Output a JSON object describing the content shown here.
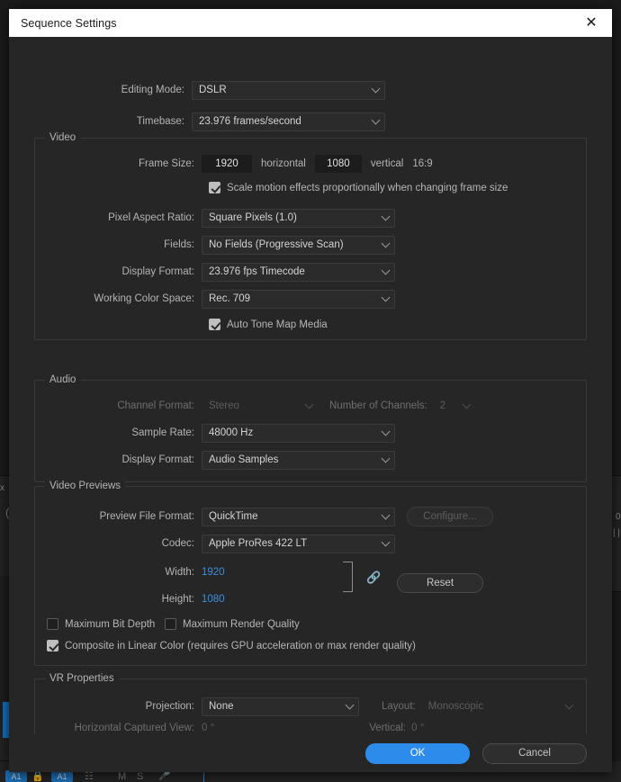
{
  "background": {
    "track_buttons": [
      "A1",
      "A1"
    ],
    "track_icons": [
      "lock-icon",
      "timeline-icon",
      "M",
      "S",
      "mic-icon"
    ],
    "panel_glyphs": [
      "x",
      "(",
      "0"
    ]
  },
  "dialog": {
    "title": "Sequence Settings",
    "close_icon": "close-icon",
    "top_fields": [
      {
        "label": "Editing Mode:",
        "value": "DSLR",
        "disabled": false
      },
      {
        "label": "Timebase:",
        "value": "23.976  frames/second",
        "disabled": false
      }
    ],
    "video": {
      "legend": "Video",
      "frame_size_label": "Frame Size:",
      "frame_width": "1920",
      "horizontal_label": "horizontal",
      "frame_height": "1080",
      "vertical_label": "vertical",
      "aspect_ratio": "16:9",
      "scale_motion": {
        "label": "Scale motion effects proportionally when changing frame size",
        "checked": true
      },
      "fields": [
        {
          "label": "Pixel Aspect Ratio:",
          "value": "Square Pixels (1.0)"
        },
        {
          "label": "Fields:",
          "value": "No Fields (Progressive Scan)"
        },
        {
          "label": "Display Format:",
          "value": "23.976 fps Timecode"
        },
        {
          "label": "Working Color Space:",
          "value": "Rec. 709"
        }
      ],
      "auto_tone_map": {
        "label": "Auto Tone Map Media",
        "checked": true
      }
    },
    "audio": {
      "legend": "Audio",
      "channel_format_label": "Channel Format:",
      "channel_format_value": "Stereo",
      "number_of_channels_label": "Number of Channels:",
      "number_of_channels_value": "2",
      "fields": [
        {
          "label": "Sample Rate:",
          "value": "48000 Hz"
        },
        {
          "label": "Display Format:",
          "value": "Audio Samples"
        }
      ]
    },
    "video_previews": {
      "legend": "Video Previews",
      "preview_file_format_label": "Preview File Format:",
      "preview_file_format_value": "QuickTime",
      "configure_label": "Configure...",
      "codec_label": "Codec:",
      "codec_value": "Apple ProRes 422 LT",
      "width_label": "Width:",
      "width_value": "1920",
      "height_label": "Height:",
      "height_value": "1080",
      "link_icon": "chain-link-icon",
      "reset_label": "Reset",
      "max_bit_depth": {
        "label": "Maximum Bit Depth",
        "checked": false
      },
      "max_render_quality": {
        "label": "Maximum Render Quality",
        "checked": false
      },
      "composite_linear": {
        "label": "Composite in Linear Color (requires GPU acceleration or max render quality)",
        "checked": true
      }
    },
    "vr": {
      "legend": "VR Properties",
      "projection_label": "Projection:",
      "projection_value": "None",
      "layout_label": "Layout:",
      "layout_value": "Monoscopic",
      "horizontal_captured_label": "Horizontal Captured View:",
      "horizontal_captured_value": "0 °",
      "vertical_label": "Vertical:",
      "vertical_value": "0 °"
    },
    "footer": {
      "ok_label": "OK",
      "cancel_label": "Cancel"
    }
  },
  "colors": {
    "accent": "#2d8ceb",
    "link_blue": "#3b8ee0",
    "dialog_bg": "#262626",
    "titlebar_bg": "#ffffff"
  }
}
